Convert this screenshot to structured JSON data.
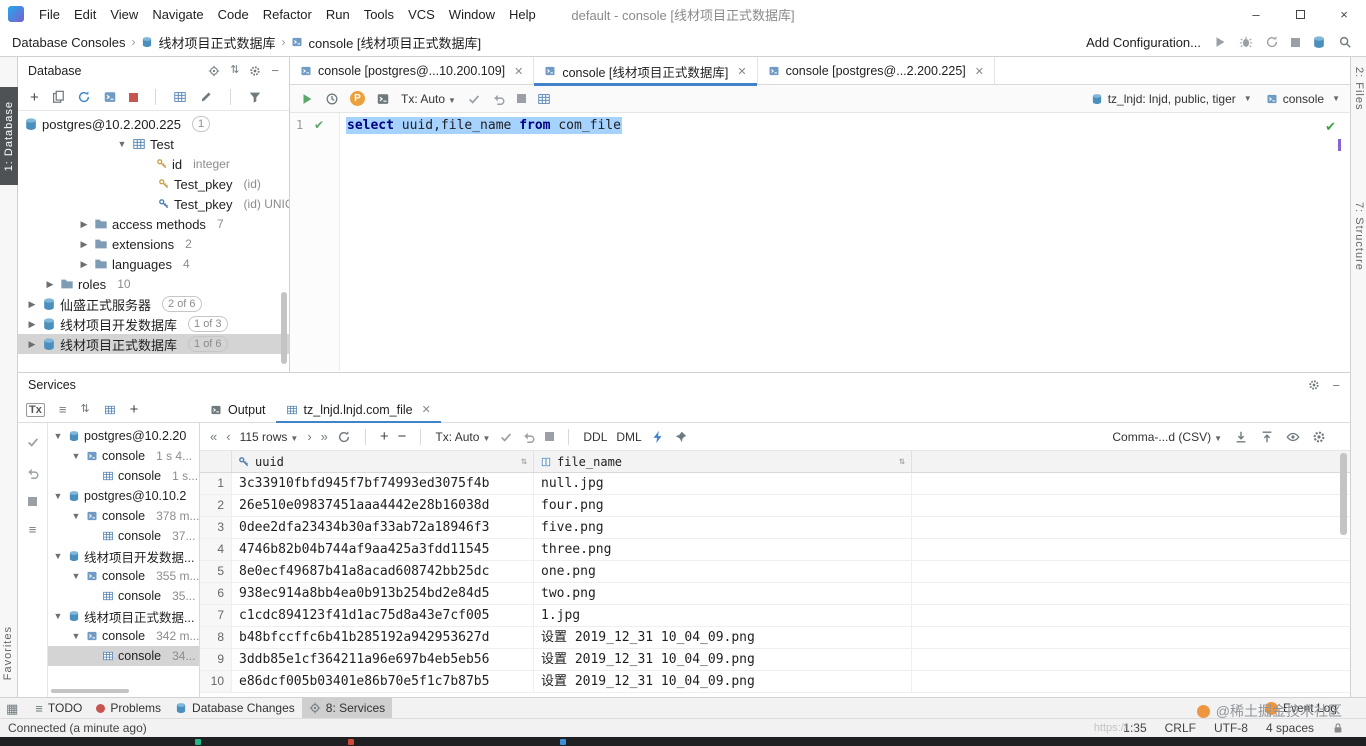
{
  "titlebar": {
    "menus": [
      "File",
      "Edit",
      "View",
      "Navigate",
      "Code",
      "Refactor",
      "Run",
      "Tools",
      "VCS",
      "Window",
      "Help"
    ],
    "title": "default - console [线材项目正式数据库]"
  },
  "navbar": {
    "crumb1": "Database Consoles",
    "crumb2": "线材项目正式数据库",
    "crumb3": "console [线材项目正式数据库]",
    "add_configuration": "Add Configuration..."
  },
  "stripes": {
    "left_top": "1: Database",
    "left_bottom": "Favorites",
    "right_top": "2: Files",
    "right_bottom": "7: Structure"
  },
  "database_panel": {
    "title": "Database",
    "tree": [
      {
        "label": "postgres@10.2.200.225",
        "badge": "1"
      },
      {
        "label": "Test"
      },
      {
        "label": "id",
        "meta": "integer"
      },
      {
        "label": "Test_pkey",
        "meta": "(id)"
      },
      {
        "label": "Test_pkey",
        "meta": "(id) UNIC"
      },
      {
        "label": "access methods",
        "badge": "7"
      },
      {
        "label": "extensions",
        "badge": "2"
      },
      {
        "label": "languages",
        "badge": "4"
      },
      {
        "label": "roles",
        "badge": "10"
      },
      {
        "label": "仙盛正式服务器",
        "badge": "2 of 6"
      },
      {
        "label": "线材项目开发数据库",
        "badge": "1 of 3"
      },
      {
        "label": "线材项目正式数据库",
        "badge": "1 of 6"
      }
    ]
  },
  "editor": {
    "tabs": [
      {
        "label": "console [postgres@...10.200.109]"
      },
      {
        "label": "console [线材项目正式数据库]"
      },
      {
        "label": "console [postgres@...2.200.225]"
      }
    ],
    "toolbar": {
      "param_badge": "P",
      "tx": "Tx: Auto",
      "schema": "tz_lnjd: lnjd, public, tiger",
      "console": "console"
    },
    "gutter_line": "1",
    "code": {
      "t0": "select",
      "t1": " uuid,file_name ",
      "t2": "from",
      "t3": " com_file"
    }
  },
  "services": {
    "title": "Services",
    "tx_icon_label": "Tx",
    "tabs": {
      "output": "Output",
      "grid": "tz_lnjd.lnjd.com_file"
    },
    "grid_toolbar": {
      "rows": "115 rows",
      "tx": "Tx: Auto",
      "ddl": "DDL",
      "dml": "DML",
      "format": "Comma-...d (CSV)"
    },
    "tree": [
      {
        "label": "postgres@10.2.20"
      },
      {
        "label": "console",
        "meta": "1 s 4..."
      },
      {
        "label": "console",
        "meta": "1 s..."
      },
      {
        "label": "postgres@10.10.2"
      },
      {
        "label": "console",
        "meta": "378 m..."
      },
      {
        "label": "console",
        "meta": "37..."
      },
      {
        "label": "线材项目开发数据..."
      },
      {
        "label": "console",
        "meta": "355 m..."
      },
      {
        "label": "console",
        "meta": "35..."
      },
      {
        "label": "线材项目正式数据..."
      },
      {
        "label": "console",
        "meta": "342 m..."
      },
      {
        "label": "console",
        "meta": "34..."
      }
    ],
    "table": {
      "columns": [
        "uuid",
        "file_name"
      ],
      "rows": [
        {
          "n": "1",
          "uuid": "3c33910fbfd945f7bf74993ed3075f4b",
          "file": "null.jpg"
        },
        {
          "n": "2",
          "uuid": "26e510e09837451aaa4442e28b16038d",
          "file": "four.png"
        },
        {
          "n": "3",
          "uuid": "0dee2dfa23434b30af33ab72a18946f3",
          "file": "five.png"
        },
        {
          "n": "4",
          "uuid": "4746b82b04b744af9aa425a3fdd11545",
          "file": "three.png"
        },
        {
          "n": "5",
          "uuid": "8e0ecf49687b41a8acad608742bb25dc",
          "file": "one.png"
        },
        {
          "n": "6",
          "uuid": "938ec914a8bb4ea0b913b254bd2e84d5",
          "file": "two.png"
        },
        {
          "n": "7",
          "uuid": "c1cdc894123f41d1ac75d8a43e7cf005",
          "file": "1.jpg"
        },
        {
          "n": "8",
          "uuid": "b48bfccffc6b41b285192a942953627d",
          "file": "设置 2019_12_31 10_04_09.png"
        },
        {
          "n": "9",
          "uuid": "3ddb85e1cf364211a96e697b4eb5eb56",
          "file": "设置 2019_12_31 10_04_09.png"
        },
        {
          "n": "10",
          "uuid": "e86dcf005b03401e86b70e5f1c7b87b5",
          "file": "设置 2019_12_31 10_04_09.png"
        }
      ]
    }
  },
  "statusbar": {
    "tabs": [
      {
        "label": "TODO"
      },
      {
        "label": "Problems"
      },
      {
        "label": "Database Changes"
      },
      {
        "label": "8: Services"
      }
    ],
    "event_log": "Event Log",
    "connected": "Connected (a minute ago)",
    "caret": "1:35",
    "line_sep": "CRLF",
    "encoding": "UTF-8",
    "indent": "4 spaces",
    "watermark": "@稀土掘金技术社区",
    "watermark_url": "https://..."
  }
}
